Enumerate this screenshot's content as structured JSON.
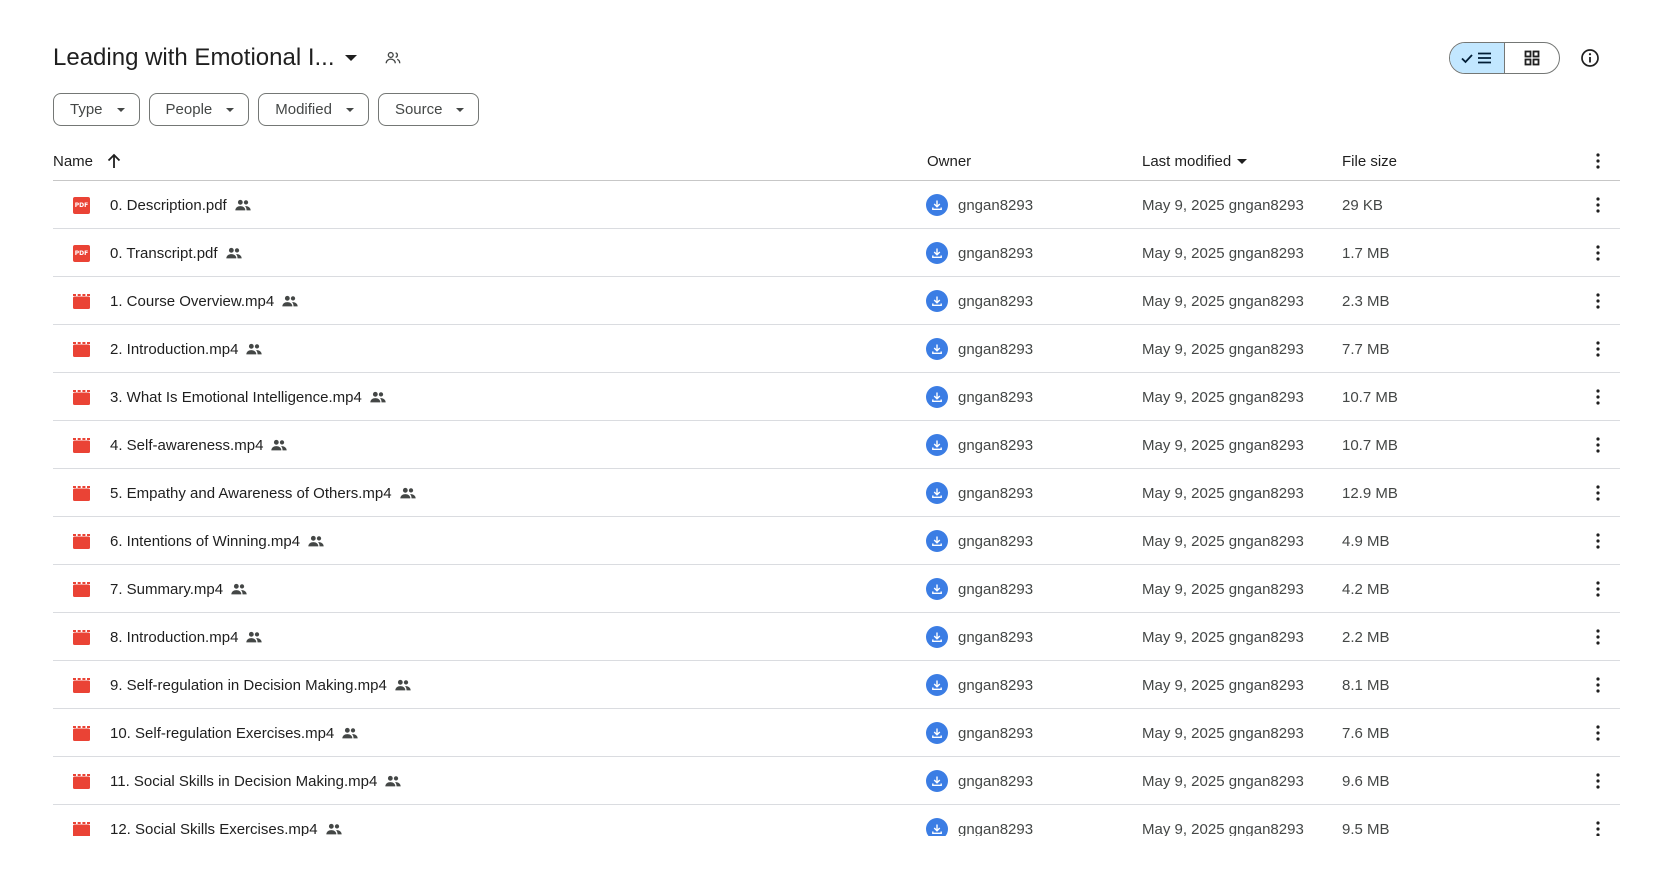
{
  "folder": {
    "title": "Leading with Emotional I..."
  },
  "filters": [
    {
      "label": "Type"
    },
    {
      "label": "People"
    },
    {
      "label": "Modified"
    },
    {
      "label": "Source"
    }
  ],
  "columns": {
    "name": "Name",
    "owner": "Owner",
    "last_modified": "Last modified",
    "file_size": "File size"
  },
  "accent_color": "#c2e7ff",
  "pdf_color": "#ea4335",
  "video_color": "#ea4335",
  "avatar_color": "#3b7de4",
  "files": [
    {
      "name": "0. Description.pdf",
      "type": "pdf",
      "owner": "gngan8293",
      "modified": "May 9, 2025 gngan8293",
      "size": "29 KB"
    },
    {
      "name": "0. Transcript.pdf",
      "type": "pdf",
      "owner": "gngan8293",
      "modified": "May 9, 2025 gngan8293",
      "size": "1.7 MB"
    },
    {
      "name": "1. Course Overview.mp4",
      "type": "video",
      "owner": "gngan8293",
      "modified": "May 9, 2025 gngan8293",
      "size": "2.3 MB"
    },
    {
      "name": "2. Introduction.mp4",
      "type": "video",
      "owner": "gngan8293",
      "modified": "May 9, 2025 gngan8293",
      "size": "7.7 MB"
    },
    {
      "name": "3. What Is Emotional Intelligence.mp4",
      "type": "video",
      "owner": "gngan8293",
      "modified": "May 9, 2025 gngan8293",
      "size": "10.7 MB"
    },
    {
      "name": "4. Self-awareness.mp4",
      "type": "video",
      "owner": "gngan8293",
      "modified": "May 9, 2025 gngan8293",
      "size": "10.7 MB"
    },
    {
      "name": "5. Empathy and Awareness of Others.mp4",
      "type": "video",
      "owner": "gngan8293",
      "modified": "May 9, 2025 gngan8293",
      "size": "12.9 MB"
    },
    {
      "name": "6. Intentions of Winning.mp4",
      "type": "video",
      "owner": "gngan8293",
      "modified": "May 9, 2025 gngan8293",
      "size": "4.9 MB"
    },
    {
      "name": "7. Summary.mp4",
      "type": "video",
      "owner": "gngan8293",
      "modified": "May 9, 2025 gngan8293",
      "size": "4.2 MB"
    },
    {
      "name": "8. Introduction.mp4",
      "type": "video",
      "owner": "gngan8293",
      "modified": "May 9, 2025 gngan8293",
      "size": "2.2 MB"
    },
    {
      "name": "9. Self-regulation in Decision Making.mp4",
      "type": "video",
      "owner": "gngan8293",
      "modified": "May 9, 2025 gngan8293",
      "size": "8.1 MB"
    },
    {
      "name": "10. Self-regulation Exercises.mp4",
      "type": "video",
      "owner": "gngan8293",
      "modified": "May 9, 2025 gngan8293",
      "size": "7.6 MB"
    },
    {
      "name": "11. Social Skills in Decision Making.mp4",
      "type": "video",
      "owner": "gngan8293",
      "modified": "May 9, 2025 gngan8293",
      "size": "9.6 MB"
    },
    {
      "name": "12. Social Skills Exercises.mp4",
      "type": "video",
      "owner": "gngan8293",
      "modified": "May 9, 2025 gngan8293",
      "size": "9.5 MB"
    }
  ]
}
